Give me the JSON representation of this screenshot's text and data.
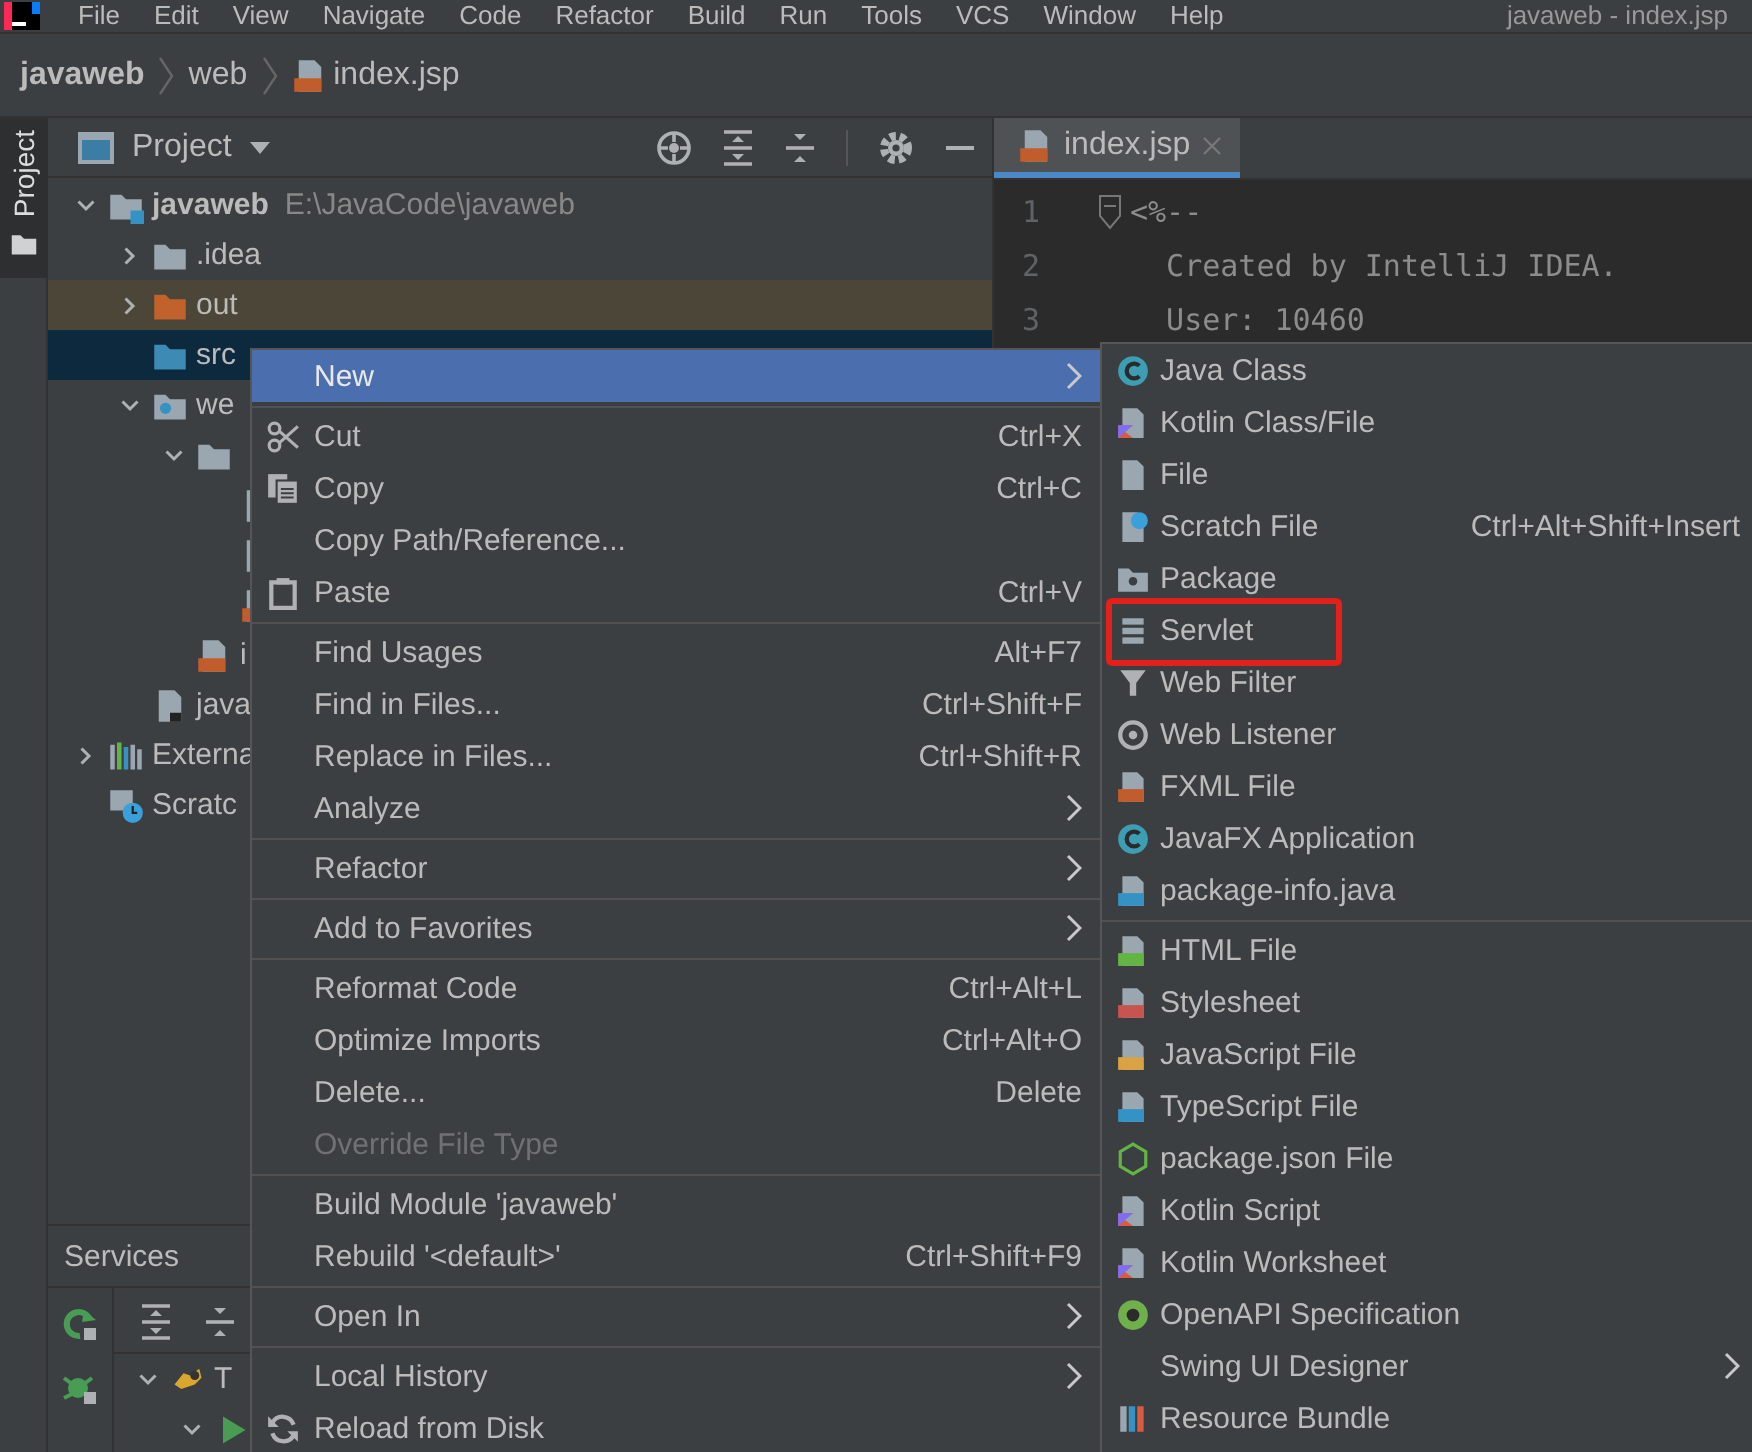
{
  "menubar": {
    "items": [
      "File",
      "Edit",
      "View",
      "Navigate",
      "Code",
      "Refactor",
      "Build",
      "Run",
      "Tools",
      "VCS",
      "Window",
      "Help"
    ],
    "window_title": "javaweb - index.jsp"
  },
  "breadcrumbs": [
    {
      "label": "javaweb",
      "kind": "project"
    },
    {
      "label": "web",
      "kind": "folder"
    },
    {
      "label": "index.jsp",
      "kind": "jsp"
    }
  ],
  "tool_stripe": {
    "tabs": [
      {
        "label": "Project",
        "selected": true
      }
    ]
  },
  "project_panel": {
    "title": "Project",
    "tree": [
      {
        "label": "javaweb",
        "kind": "module",
        "path": "E:\\JavaCode\\javaweb",
        "expanded": true,
        "selected": false,
        "children": [
          {
            "label": ".idea",
            "kind": "folder",
            "expanded": false,
            "selected": false
          },
          {
            "label": "out",
            "kind": "excluded-folder",
            "expanded": false,
            "selected": false
          },
          {
            "label": "src",
            "kind": "source-folder",
            "selected": true
          },
          {
            "label": "we",
            "kind": "web-folder",
            "expanded": true,
            "selected": false,
            "children": [
              {
                "kind": "folder",
                "expanded": true,
                "selected": false,
                "children": [
                  {
                    "kind": "file",
                    "selected": false
                  },
                  {
                    "kind": "file",
                    "selected": false
                  },
                  {
                    "kind": "jsp",
                    "selected": false
                  }
                ]
              },
              {
                "label": "i",
                "kind": "jsp",
                "selected": false
              }
            ]
          },
          {
            "label": "java",
            "kind": "iml",
            "selected": false
          }
        ]
      },
      {
        "label": "Externa",
        "kind": "libraries",
        "expanded": false,
        "selected": false
      },
      {
        "label": "Scratc",
        "kind": "scratches",
        "selected": false
      }
    ]
  },
  "services_panel": {
    "title": "Services",
    "tree": [
      {
        "label": "T",
        "kind": "tomcat",
        "expanded": true,
        "children": [
          {
            "kind": "run",
            "expanded": true
          }
        ]
      }
    ]
  },
  "editor": {
    "tabs": [
      {
        "label": "index.jsp",
        "selected": true
      }
    ],
    "lines": [
      {
        "number": "1",
        "text": "<%--",
        "fold": true
      },
      {
        "number": "2",
        "text": "  Created by IntelliJ IDEA.",
        "fold": false
      },
      {
        "number": "3",
        "text": "  User: 10460",
        "fold": false
      }
    ]
  },
  "context_menu": {
    "groups": [
      [
        {
          "label": "New",
          "kind": "plain",
          "submenu": true,
          "selected": true,
          "disabled": false
        }
      ],
      [
        {
          "label": "Cut",
          "shortcut": "Ctrl+X",
          "kind": "scissors",
          "submenu": false,
          "selected": false,
          "disabled": false
        },
        {
          "label": "Copy",
          "shortcut": "Ctrl+C",
          "kind": "copy",
          "submenu": false,
          "selected": false,
          "disabled": false
        },
        {
          "label": "Copy Path/Reference...",
          "kind": "plain",
          "submenu": false,
          "selected": false,
          "disabled": false
        },
        {
          "label": "Paste",
          "shortcut": "Ctrl+V",
          "kind": "paste",
          "submenu": false,
          "selected": false,
          "disabled": false
        }
      ],
      [
        {
          "label": "Find Usages",
          "shortcut": "Alt+F7",
          "kind": "plain",
          "submenu": false,
          "selected": false,
          "disabled": false
        },
        {
          "label": "Find in Files...",
          "shortcut": "Ctrl+Shift+F",
          "kind": "plain",
          "submenu": false,
          "selected": false,
          "disabled": false
        },
        {
          "label": "Replace in Files...",
          "shortcut": "Ctrl+Shift+R",
          "kind": "plain",
          "submenu": false,
          "selected": false,
          "disabled": false
        },
        {
          "label": "Analyze",
          "kind": "plain",
          "submenu": true,
          "selected": false,
          "disabled": false
        }
      ],
      [
        {
          "label": "Refactor",
          "kind": "plain",
          "submenu": true,
          "selected": false,
          "disabled": false
        }
      ],
      [
        {
          "label": "Add to Favorites",
          "kind": "plain",
          "submenu": true,
          "selected": false,
          "disabled": false
        }
      ],
      [
        {
          "label": "Reformat Code",
          "shortcut": "Ctrl+Alt+L",
          "kind": "plain",
          "submenu": false,
          "selected": false,
          "disabled": false
        },
        {
          "label": "Optimize Imports",
          "shortcut": "Ctrl+Alt+O",
          "kind": "plain",
          "submenu": false,
          "selected": false,
          "disabled": false
        },
        {
          "label": "Delete...",
          "shortcut": "Delete",
          "kind": "plain",
          "submenu": false,
          "selected": false,
          "disabled": false
        },
        {
          "label": "Override File Type",
          "kind": "plain",
          "submenu": false,
          "selected": false,
          "disabled": true
        }
      ],
      [
        {
          "label": "Build Module 'javaweb'",
          "kind": "plain",
          "submenu": false,
          "selected": false,
          "disabled": false
        },
        {
          "label": "Rebuild '<default>'",
          "shortcut": "Ctrl+Shift+F9",
          "kind": "plain",
          "submenu": false,
          "selected": false,
          "disabled": false
        }
      ],
      [
        {
          "label": "Open In",
          "kind": "plain",
          "submenu": true,
          "selected": false,
          "disabled": false
        }
      ],
      [
        {
          "label": "Local History",
          "kind": "plain",
          "submenu": true,
          "selected": false,
          "disabled": false
        },
        {
          "label": "Reload from Disk",
          "kind": "reload",
          "submenu": false,
          "selected": false,
          "disabled": false
        }
      ]
    ]
  },
  "submenu": {
    "groups": [
      [
        {
          "label": "Java Class",
          "kind": "class",
          "submenu": false,
          "selected": false,
          "highlighted": false
        },
        {
          "label": "Kotlin Class/File",
          "kind": "kotlin",
          "submenu": false,
          "selected": false,
          "highlighted": false
        },
        {
          "label": "File",
          "kind": "file",
          "submenu": false,
          "selected": false,
          "highlighted": false
        },
        {
          "label": "Scratch File",
          "shortcut": "Ctrl+Alt+Shift+Insert",
          "kind": "scratch",
          "submenu": false,
          "selected": false,
          "highlighted": false
        },
        {
          "label": "Package",
          "kind": "package",
          "submenu": false,
          "selected": false,
          "highlighted": false
        },
        {
          "label": "Servlet",
          "kind": "servlet",
          "submenu": false,
          "selected": false,
          "highlighted": true
        },
        {
          "label": "Web Filter",
          "kind": "filter",
          "submenu": false,
          "selected": false,
          "highlighted": false
        },
        {
          "label": "Web Listener",
          "kind": "listener",
          "submenu": false,
          "selected": false,
          "highlighted": false
        },
        {
          "label": "FXML File",
          "kind": "fxml",
          "submenu": false,
          "selected": false,
          "highlighted": false
        },
        {
          "label": "JavaFX Application",
          "kind": "class",
          "submenu": false,
          "selected": false,
          "highlighted": false
        },
        {
          "label": "package-info.java",
          "kind": "package-info",
          "submenu": false,
          "selected": false,
          "highlighted": false
        }
      ],
      [
        {
          "label": "HTML File",
          "kind": "html",
          "submenu": false,
          "selected": false,
          "highlighted": false
        },
        {
          "label": "Stylesheet",
          "kind": "css",
          "submenu": false,
          "selected": false,
          "highlighted": false
        },
        {
          "label": "JavaScript File",
          "kind": "js",
          "submenu": false,
          "selected": false,
          "highlighted": false
        },
        {
          "label": "TypeScript File",
          "kind": "ts",
          "submenu": false,
          "selected": false,
          "highlighted": false
        },
        {
          "label": "package.json File",
          "kind": "json",
          "submenu": false,
          "selected": false,
          "highlighted": false
        },
        {
          "label": "Kotlin Script",
          "kind": "kotlin",
          "submenu": false,
          "selected": false,
          "highlighted": false
        },
        {
          "label": "Kotlin Worksheet",
          "kind": "kotlin",
          "submenu": false,
          "selected": false,
          "highlighted": false
        },
        {
          "label": "OpenAPI Specification",
          "kind": "openapi",
          "submenu": false,
          "selected": false,
          "highlighted": false
        },
        {
          "label": "Swing UI Designer",
          "kind": "plain",
          "submenu": true,
          "selected": false,
          "highlighted": false
        },
        {
          "label": "Resource Bundle",
          "kind": "bundle",
          "submenu": false,
          "selected": false,
          "highlighted": false
        }
      ]
    ]
  }
}
